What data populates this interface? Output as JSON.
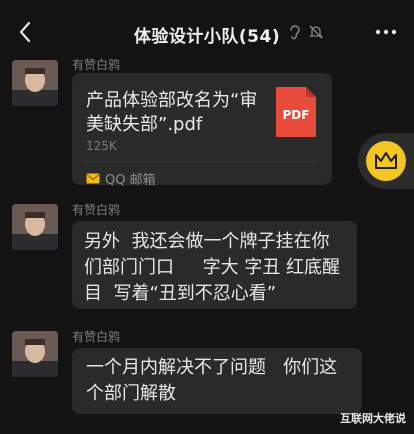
{
  "header": {
    "title": "体验设计小队(54)",
    "icons": [
      "back-icon",
      "ear-icon",
      "mute-bell-icon",
      "more-icon"
    ]
  },
  "messages": [
    {
      "sender": "有赞白鸦",
      "type": "file",
      "file_name": "产品体验部改名为“审美缺失部”.pdf",
      "file_size": "125K",
      "file_type_label": "PDF",
      "source_label": "QQ 邮箱"
    },
    {
      "sender": "有赞白鸦",
      "type": "text",
      "text": "另外  我还会做一个牌子挂在你们部门门口     字大 字丑 红底醒目  写着“丑到不忍心看”"
    },
    {
      "sender": "有赞白鸦",
      "type": "text",
      "text": "一个月内解决不了问题   你们这个部门解散"
    }
  ],
  "watermark": "互联网大佬说",
  "colors": {
    "background": "#131313",
    "bubble": "#2a2a2a",
    "pdf_red": "#e84b3c",
    "float_yellow": "#f3c623"
  }
}
